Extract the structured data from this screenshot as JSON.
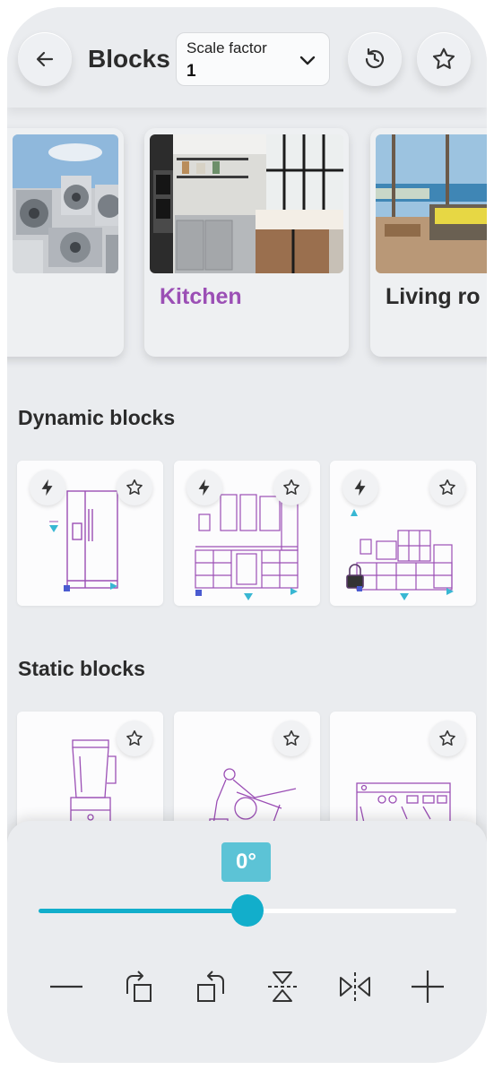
{
  "header": {
    "back_icon": "arrow-left-icon",
    "title": "Blocks",
    "scale": {
      "label": "Scale factor",
      "value": "1"
    },
    "history_icon": "history-icon",
    "favorite_icon": "star-icon"
  },
  "categories": [
    {
      "name": "",
      "image": "outdoor-units-photo"
    },
    {
      "name": "Kitchen",
      "image": "kitchen-photo",
      "selected": true
    },
    {
      "name": "Living ro",
      "image": "living-room-photo"
    }
  ],
  "dynamic_section": {
    "title": "Dynamic blocks"
  },
  "static_section": {
    "title": "Static blocks"
  },
  "rotation": {
    "angle_label": "0°",
    "slider_fraction": 0.5
  },
  "tools": [
    "minus-icon",
    "rotate-right-icon",
    "rotate-left-icon",
    "flip-vertical-icon",
    "flip-horizontal-icon",
    "plus-icon"
  ],
  "colors": {
    "accent": "#12aecb",
    "selected_category": "#9b4fb5",
    "drawing": "#9b4fb5"
  }
}
